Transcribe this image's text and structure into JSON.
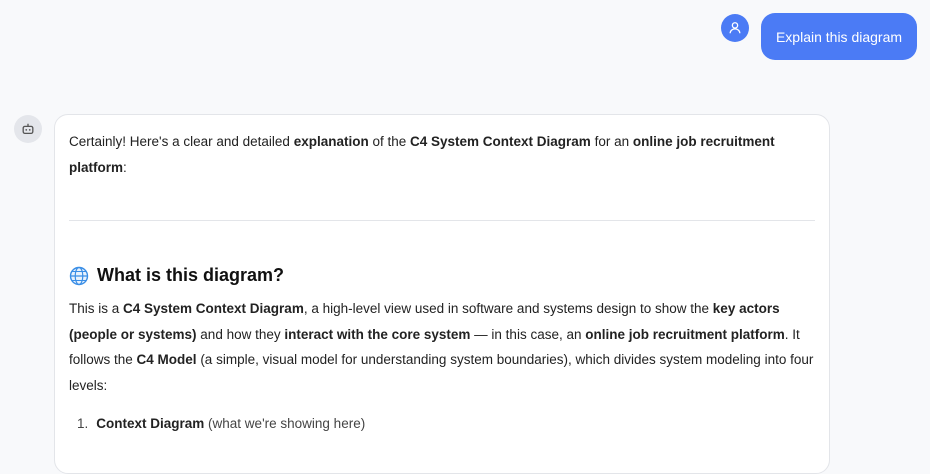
{
  "user_message": {
    "text": "Explain this diagram",
    "avatar_icon": "user-icon",
    "color": "#4b7bf5"
  },
  "bot_message": {
    "avatar_icon": "robot-icon",
    "intro": {
      "t1": "Certainly! Here's a clear and detailed ",
      "b1": "explanation",
      "t2": " of the ",
      "b2": "C4 System Context Diagram",
      "t3": " for an ",
      "b3": "online job recruitment platform",
      "t4": ":"
    },
    "section": {
      "icon": "globe-icon",
      "title": "What is this diagram?"
    },
    "paragraph": {
      "t1": "This is a ",
      "b1": "C4 System Context Diagram",
      "t2": ", a high-level view used in software and systems design to show the ",
      "b2": "key actors (people or systems)",
      "t3": " and how they ",
      "b3": "interact with the core system",
      "t4": " — in this case, an ",
      "b4": "online job recruitment platform",
      "t5": ". It follows the ",
      "b5": "C4 Model",
      "t6": " (a simple, visual model for understanding system boundaries), which divides system modeling into four levels:"
    },
    "list": [
      {
        "num": "1.",
        "bold": "Context Diagram",
        "rest": " (what we're showing here)"
      }
    ]
  }
}
